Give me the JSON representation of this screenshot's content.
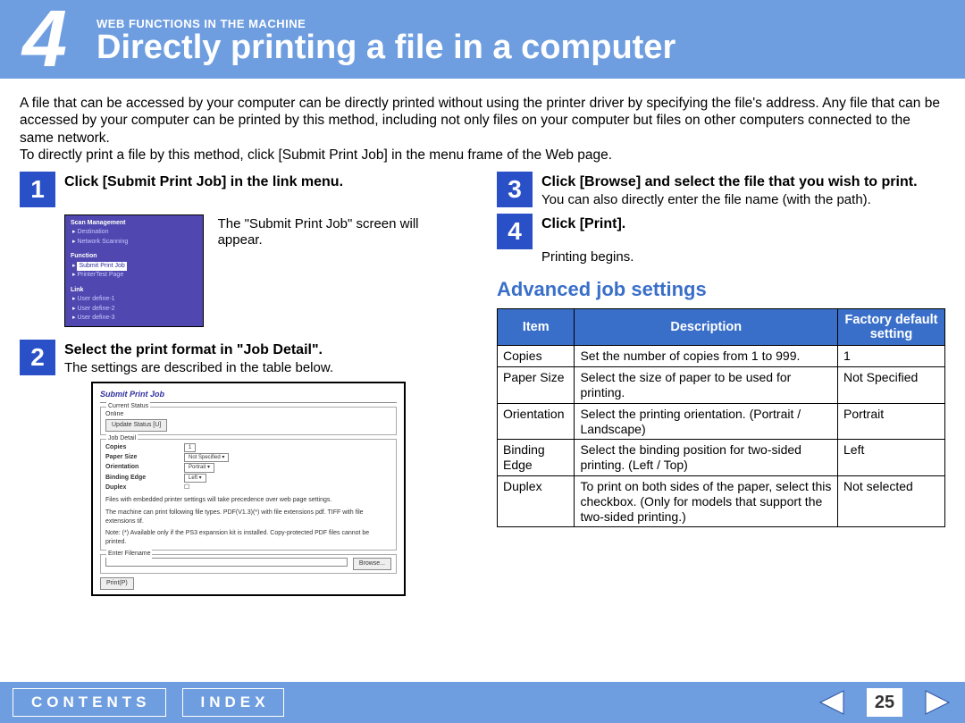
{
  "header": {
    "chapter_number": "4",
    "pretitle": "WEB FUNCTIONS IN THE MACHINE",
    "title": "Directly printing a file in a computer"
  },
  "intro": "A file that can be accessed by your computer can be directly printed without using the printer driver by specifying the file's address. Any file that can be accessed by your computer can be printed by this method, including not only files on your computer but files on other computers connected to the same network.\nTo directly print a file by this method, click [Submit Print Job] in the menu frame of the Web page.",
  "steps": {
    "s1": {
      "num": "1",
      "title": "Click [Submit Print Job] in the link menu.",
      "text": "The \"Submit Print Job\" screen will appear."
    },
    "s2": {
      "num": "2",
      "title": "Select the print format in \"Job Detail\".",
      "text": "The settings are described in the table below."
    },
    "s3": {
      "num": "3",
      "title": "Click [Browse] and select the file that you wish to print.",
      "text": "You can also directly enter the file name (with the path)."
    },
    "s4": {
      "num": "4",
      "title": "Click [Print].",
      "text": "Printing begins."
    }
  },
  "menu_fig": {
    "scan_hdr": "Scan Management",
    "scan_items": [
      "Destination",
      "Network Scanning"
    ],
    "func_hdr": "Function",
    "func_sel": "Submit Print Job",
    "func_item": "PrinterTest Page",
    "link_hdr": "Link",
    "link_items": [
      "User define-1",
      "User define-2",
      "User define-3"
    ]
  },
  "dialog_fig": {
    "title": "Submit Print Job",
    "status_sec": "Current Status",
    "status_val": "Online",
    "update_btn": "Update Status [U]",
    "detail_sec": "Job Detail",
    "rows": {
      "copies": "Copies",
      "copies_v": "1",
      "paper": "Paper Size",
      "paper_v": "Not Specified ▾",
      "orient": "Orientation",
      "orient_v": "Portrait ▾",
      "bind": "Binding Edge",
      "bind_v": "Left ▾",
      "dup": "Duplex"
    },
    "note1": "Files with embedded printer settings will take precedence over web page settings.",
    "note2": "The machine can print following file types. PDF(V1.3)(*) with file extensions pdf. TIFF with file extensions tif.",
    "note3": "Note: (*) Available only if the PS3 expansion kit is installed. Copy-protected PDF files cannot be printed.",
    "file_sec": "Enter Filename",
    "browse": "Browse...",
    "print_btn": "Print(P)"
  },
  "subhead": "Advanced job settings",
  "table": {
    "h1": "Item",
    "h2": "Description",
    "h3": "Factory default setting",
    "rows": [
      {
        "item": "Copies",
        "desc": "Set the number of copies from 1 to 999.",
        "def": "1"
      },
      {
        "item": "Paper Size",
        "desc": "Select the size of paper to be used for printing.",
        "def": "Not Specified"
      },
      {
        "item": "Orientation",
        "desc": "Select the printing orientation. (Portrait / Landscape)",
        "def": "Portrait"
      },
      {
        "item": "Binding Edge",
        "desc": "Select the binding position for two-sided printing. (Left / Top)",
        "def": "Left"
      },
      {
        "item": "Duplex",
        "desc": "To print on both sides of the paper, select this checkbox. (Only for models that support the two-sided printing.)",
        "def": "Not selected"
      }
    ]
  },
  "footer": {
    "contents": "CONTENTS",
    "index": "INDEX",
    "page": "25"
  }
}
